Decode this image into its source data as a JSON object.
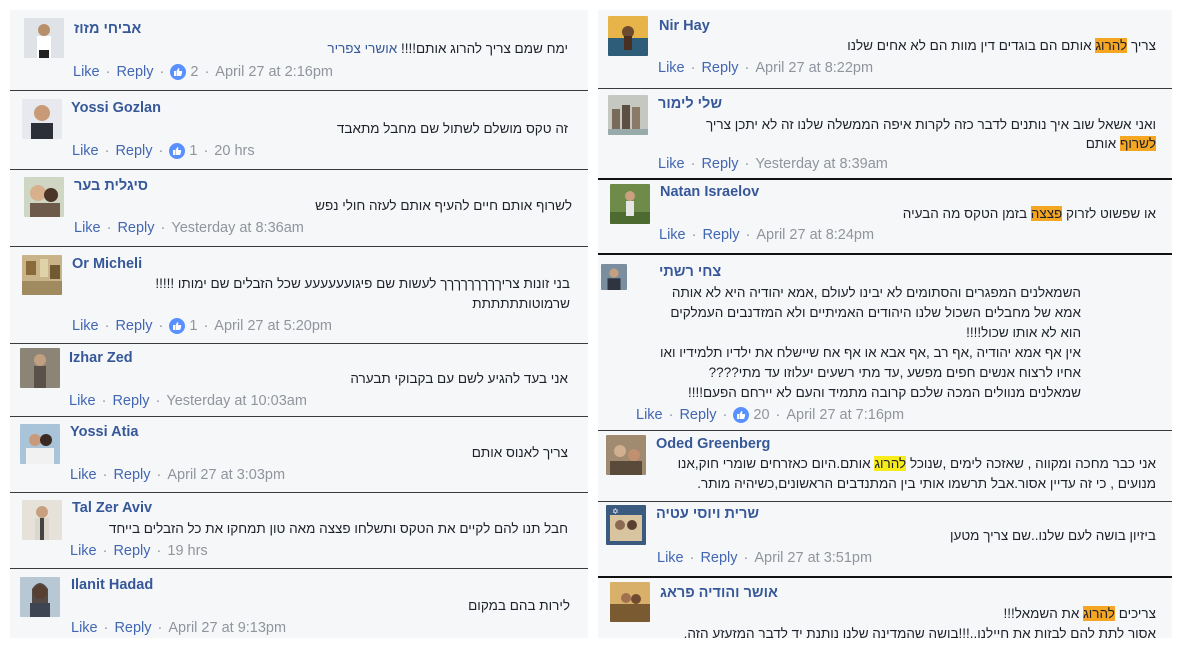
{
  "common": {
    "like": "Like",
    "reply": "Reply"
  },
  "left": [
    {
      "name": "אביחי מזוז",
      "text": "ימח שמם צריך להרוג אותם!!!! ",
      "tag": "אושרי צפריר",
      "reactions": "2",
      "time": "April 27 at 2:16pm"
    },
    {
      "name": "Yossi Gozlan",
      "text": "זה טקס מושלם לשתול שם מחבל מתאבד",
      "reactions": "1",
      "time": "20 hrs"
    },
    {
      "name": "סיגלית בער",
      "text": "לשרוף אותם חיים להעיף אותם לעזה חולי נפש",
      "time": "Yesterday at 8:36am"
    },
    {
      "name": "Or Micheli",
      "text1": "בני זונות צריךךךךךךךךך לעשות שם פיגועעעעעע שכל הזבלים שם ימותו !!!!!",
      "text2": "שרמוטותתתתתת",
      "reactions": "1",
      "time": "April 27 at 5:20pm"
    },
    {
      "name": "Izhar Zed",
      "text": "אני בעד להגיע לשם עם בקבוקי תבערה",
      "time": "Yesterday at 10:03am"
    },
    {
      "name": "Yossi Atia",
      "text": "צריך לאנוס אותם",
      "time": "April 27 at 3:03pm"
    },
    {
      "name": "Tal Zer Aviv",
      "text": "חבל תנו להם לקיים את הטקס ותשלחו פצצה מאה טון תמחקו את כל הזבלים בייחד",
      "time": "19 hrs"
    },
    {
      "name": "Ilanit Hadad",
      "text": "לירות בהם במקום",
      "time": "April 27 at 9:13pm"
    }
  ],
  "right": [
    {
      "name": "Nir Hay",
      "pre": "צריך ",
      "hl": "להרוג",
      "post": " אותם הם בוגדים דין מוות הם לא אחים שלנו",
      "time": "April 27 at 8:22pm"
    },
    {
      "name": "שלי לימור",
      "text1": "ואני אשאל שוב איך נותנים לדבר כזה לקרות איפה הממשלה שלנו זה לא יתכן צריך",
      "hl": "לשרוף",
      "post": " אותם",
      "time": "Yesterday at 8:39am"
    },
    {
      "name": "Natan Israelov",
      "pre": "או שפשוט לזרוק ",
      "hl": "פצצה",
      "post": " בזמן הטקס מה הבעיה",
      "time": "April 27 at 8:24pm"
    },
    {
      "name": "צחי רשתי",
      "lines": [
        "השמאלנים המפגרים והסתומים לא יבינו לעולם ,אמא יהודיה היא לא אותה",
        "אמא של מחבלים השכול שלנו היהודים האמיתיים ולא המזדנבים העמלקים",
        "הוא לא אותו שכול!!!!",
        "אין אף אמא יהודיה ,אף רב ,אף אבא או אף אח שיישלח את ילדיו תלמידיו ואו",
        "אחיו לרצוח אנשים חפים מפשע ,עד מתי רשעים יעלוזו עד מתי????",
        "שמאלנים מנוולים המכה שלכם קרובה מתמיד והעם לא יירחם הפעם!!!!"
      ],
      "reactions": "20",
      "time": "April 27 at 7:16pm"
    },
    {
      "name": "Oded Greenberg",
      "pre": "אני כבר מחכה ומקווה , שאזכה לימים ,שנוכל ",
      "hl": "להרוג",
      "post": " אותם.היום כאזרחים שומרי חוק,אנו",
      "line2": "מנועים , כי זה עדיין אסור.אבל תרשמו אותי בין המתנדבים הראשונים,כשיהיה מותר.",
      "time": ""
    },
    {
      "name": "שרית ויוסי עטיה",
      "text": "ביזיון בושה לעם שלנו..שם צריך מטען",
      "time": "April 27 at 3:51pm"
    },
    {
      "name": "אושר והודיה פראג",
      "pre": "צריכים ",
      "hl": "להרוג",
      "post": " את השמאל!!!",
      "line2": "אסור לתת להם לבזות את חיילנו..!!!בושה שהמדינה שלנו נותנת יד לדבר המזעזע הזה."
    }
  ]
}
